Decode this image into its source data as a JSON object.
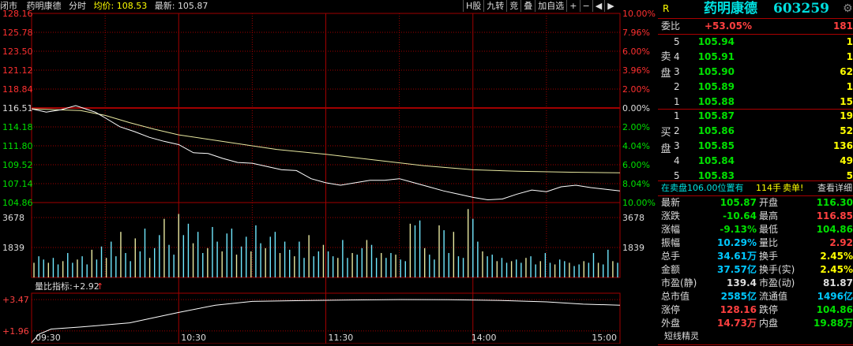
{
  "header": {
    "status": "闭市",
    "name": "药明康德",
    "mode": "分时",
    "avg_label": "均价:",
    "avg_value": "108.53",
    "last_label": "最新:",
    "last_value": "105.87"
  },
  "toolbar": {
    "items": [
      "H股",
      "九转",
      "竞",
      "叠",
      "加自选",
      "+",
      "−",
      "◀",
      "▶"
    ]
  },
  "panel": {
    "flag": "R",
    "title": "药明康德",
    "code": "603259",
    "weibi_label": "委比",
    "weibi_value": "+53.05%",
    "weibi_vol": "181",
    "sell_label": "卖盘",
    "buy_label": "买盘",
    "asks": [
      {
        "lvl": "5",
        "price": "105.94",
        "vol": "1"
      },
      {
        "lvl": "4",
        "price": "105.91",
        "vol": "1"
      },
      {
        "lvl": "3",
        "price": "105.90",
        "vol": "62"
      },
      {
        "lvl": "2",
        "price": "105.89",
        "vol": "1"
      },
      {
        "lvl": "1",
        "price": "105.88",
        "vol": "15"
      }
    ],
    "bids": [
      {
        "lvl": "1",
        "price": "105.87",
        "vol": "19"
      },
      {
        "lvl": "2",
        "price": "105.86",
        "vol": "52"
      },
      {
        "lvl": "3",
        "price": "105.85",
        "vol": "136"
      },
      {
        "lvl": "4",
        "price": "105.84",
        "vol": "49"
      },
      {
        "lvl": "5",
        "price": "105.83",
        "vol": "5"
      }
    ],
    "notice": {
      "text": "在卖盘106.00位置有",
      "vol": "114手",
      "act": "卖单!",
      "link": "查看详细"
    },
    "stats": [
      {
        "k1": "最新",
        "v1": "105.87",
        "c1": "#00e000",
        "k2": "开盘",
        "v2": "116.30",
        "c2": "#00e000"
      },
      {
        "k1": "涨跌",
        "v1": "-10.64",
        "c1": "#00e000",
        "k2": "最高",
        "v2": "116.85",
        "c2": "#ff4040"
      },
      {
        "k1": "涨幅",
        "v1": "-9.13%",
        "c1": "#00e000",
        "k2": "最低",
        "v2": "104.86",
        "c2": "#00e000"
      },
      {
        "k1": "振幅",
        "v1": "10.29%",
        "c1": "#00c8ff",
        "k2": "量比",
        "v2": "2.92",
        "c2": "#ff4040"
      },
      {
        "k1": "总手",
        "v1": "34.61万",
        "c1": "#00c8ff",
        "k2": "换手",
        "v2": "2.45%",
        "c2": "#ffff00"
      },
      {
        "k1": "金额",
        "v1": "37.57亿",
        "c1": "#00c8ff",
        "k2": "换手(实)",
        "v2": "2.45%",
        "c2": "#ffff00"
      },
      {
        "k1": "市盈(静)",
        "v1": "139.4",
        "c1": "#dddddd",
        "k2": "市盈(动)",
        "v2": "81.87",
        "c2": "#dddddd"
      },
      {
        "k1": "总市值",
        "v1": "2585亿",
        "c1": "#00c8ff",
        "k2": "流通值",
        "v2": "1496亿",
        "c2": "#00c8ff"
      },
      {
        "k1": "涨停",
        "v1": "128.16",
        "c1": "#ff4040",
        "k2": "跌停",
        "v2": "104.86",
        "c2": "#00e000"
      },
      {
        "k1": "外盘",
        "v1": "14.73万",
        "c1": "#ff4040",
        "k2": "内盘",
        "v2": "19.88万",
        "c2": "#00e000"
      }
    ],
    "footer": "短线精灵"
  },
  "chart_data": {
    "type": "line",
    "price_axis": {
      "ticks": [
        "128.16",
        "125.78",
        "123.50",
        "121.12",
        "118.84",
        "116.51",
        "114.18",
        "111.80",
        "109.52",
        "107.14",
        "104.86"
      ],
      "ylim": [
        104.86,
        128.16
      ],
      "prev_close": 116.51
    },
    "pct_axis": {
      "ticks": [
        "10.00%",
        "7.96%",
        "6.00%",
        "3.96%",
        "2.00%",
        "0.00%",
        "2.00%",
        "4.04%",
        "6.00%",
        "8.04%",
        "10.00%"
      ]
    },
    "volume_axis": {
      "ticks": [
        "3678",
        "1839"
      ]
    },
    "ratio_indicator": {
      "label": "量比指标:",
      "value": "+2.92",
      "arrow": "↑",
      "ticks": [
        "+3.47",
        "+1.96"
      ]
    },
    "x_ticks": [
      "09:30",
      "10:30",
      "11:30",
      "14:00",
      "15:00"
    ],
    "price_series": [
      [
        0,
        116.4
      ],
      [
        6,
        116.0
      ],
      [
        12,
        116.3
      ],
      [
        18,
        116.8
      ],
      [
        22,
        116.4
      ],
      [
        26,
        116.0
      ],
      [
        30,
        115.3
      ],
      [
        36,
        114.2
      ],
      [
        42,
        113.6
      ],
      [
        48,
        112.9
      ],
      [
        54,
        112.4
      ],
      [
        60,
        112.0
      ],
      [
        66,
        111.0
      ],
      [
        72,
        110.9
      ],
      [
        78,
        110.3
      ],
      [
        84,
        109.8
      ],
      [
        90,
        109.7
      ],
      [
        96,
        109.3
      ],
      [
        102,
        108.9
      ],
      [
        108,
        108.8
      ],
      [
        114,
        107.8
      ],
      [
        120,
        107.3
      ],
      [
        126,
        107.0
      ],
      [
        132,
        107.3
      ],
      [
        138,
        107.6
      ],
      [
        144,
        107.6
      ],
      [
        150,
        107.8
      ],
      [
        156,
        107.3
      ],
      [
        162,
        106.8
      ],
      [
        168,
        106.3
      ],
      [
        174,
        105.9
      ],
      [
        180,
        105.5
      ],
      [
        186,
        105.2
      ],
      [
        192,
        105.3
      ],
      [
        198,
        105.9
      ],
      [
        204,
        106.4
      ],
      [
        210,
        106.2
      ],
      [
        216,
        106.8
      ],
      [
        222,
        107.0
      ],
      [
        228,
        106.7
      ],
      [
        234,
        106.5
      ],
      [
        240,
        106.3
      ]
    ],
    "avg_series": [
      [
        0,
        116.4
      ],
      [
        10,
        116.3
      ],
      [
        20,
        116.2
      ],
      [
        30,
        115.6
      ],
      [
        40,
        114.7
      ],
      [
        50,
        113.9
      ],
      [
        60,
        113.2
      ],
      [
        80,
        112.3
      ],
      [
        100,
        111.4
      ],
      [
        120,
        110.8
      ],
      [
        140,
        110.1
      ],
      [
        160,
        109.4
      ],
      [
        180,
        108.9
      ],
      [
        200,
        108.7
      ],
      [
        220,
        108.6
      ],
      [
        240,
        108.53
      ]
    ],
    "volume_values": [
      900,
      1300,
      1100,
      900,
      1200,
      800,
      1000,
      1500,
      900,
      1100,
      1300,
      800,
      1700,
      1100,
      1900,
      1200,
      2200,
      1300,
      2800,
      1500,
      1000,
      2400,
      1600,
      3000,
      1200,
      1800,
      2600,
      3600,
      2000,
      1400,
      3900,
      2600,
      3300,
      2100,
      2800,
      1500,
      1800,
      3100,
      2200,
      1600,
      2700,
      3000,
      1400,
      1900,
      2500,
      1600,
      3200,
      2100,
      1800,
      2500,
      2800,
      1500,
      2200,
      1700,
      1300,
      2200,
      1200,
      2600,
      1300,
      1600,
      2000,
      1600,
      1300,
      1200,
      2300,
      1200,
      1500,
      1400,
      1800,
      2300,
      2000,
      1200,
      1500,
      1200,
      1500,
      1400,
      1100,
      1000,
      3300,
      3200,
      3500,
      1800,
      1400,
      1100,
      3200,
      2900,
      1500,
      2800,
      1300,
      1200,
      4200,
      3600,
      2200,
      1600,
      1300,
      1400,
      1000,
      1200,
      900,
      1000,
      1100,
      900,
      1200,
      1300,
      800,
      1000,
      1500,
      900,
      800,
      1100,
      1000,
      900,
      700,
      800,
      1000,
      900,
      1500,
      900,
      800,
      1700,
      1000,
      900
    ],
    "ratio_series": [
      [
        0,
        1.4
      ],
      [
        3,
        1.8
      ],
      [
        8,
        2.05
      ],
      [
        20,
        2.15
      ],
      [
        40,
        2.35
      ],
      [
        50,
        2.6
      ],
      [
        60,
        2.85
      ],
      [
        75,
        3.2
      ],
      [
        90,
        3.38
      ],
      [
        110,
        3.42
      ],
      [
        130,
        3.45
      ],
      [
        150,
        3.47
      ],
      [
        170,
        3.46
      ],
      [
        190,
        3.43
      ],
      [
        210,
        3.36
      ],
      [
        225,
        3.25
      ],
      [
        240,
        3.2
      ]
    ],
    "ratio_ylim": [
      1.35,
      3.7
    ],
    "grid": true,
    "colors": {
      "price": "#ffffff",
      "avg": "#e8e8a0",
      "grid": "#a00000",
      "axis_red": "#ff3030",
      "axis_green": "#00e000"
    }
  }
}
